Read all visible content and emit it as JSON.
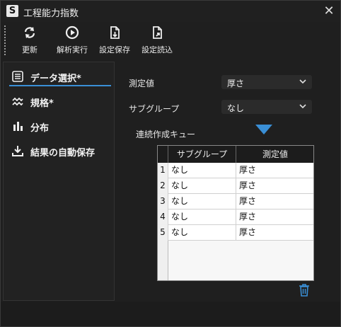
{
  "window": {
    "app_icon_letter": "S",
    "title": "工程能力指数"
  },
  "toolbar": {
    "update": "更新",
    "analyze": "解析実行",
    "save_settings": "設定保存",
    "load_settings": "設定読込"
  },
  "sidebar": {
    "items": [
      {
        "label": "データ選択*",
        "active": true
      },
      {
        "label": "規格*"
      },
      {
        "label": "分布"
      },
      {
        "label": "結果の自動保存"
      }
    ]
  },
  "form": {
    "measure_label": "測定値",
    "measure_value": "厚さ",
    "subgroup_label": "サブグループ",
    "subgroup_value": "なし",
    "queue_label": "連続作成キュー"
  },
  "table": {
    "headers": [
      "サブグループ",
      "測定値"
    ],
    "rows": [
      {
        "num": "1",
        "subgroup": "なし",
        "measure": "厚さ"
      },
      {
        "num": "2",
        "subgroup": "なし",
        "measure": "厚さ"
      },
      {
        "num": "3",
        "subgroup": "なし",
        "measure": "厚さ"
      },
      {
        "num": "4",
        "subgroup": "なし",
        "measure": "厚さ"
      },
      {
        "num": "5",
        "subgroup": "なし",
        "measure": "厚さ"
      }
    ]
  },
  "colors": {
    "accent": "#3a8fd6",
    "background": "#1f1f1f"
  }
}
